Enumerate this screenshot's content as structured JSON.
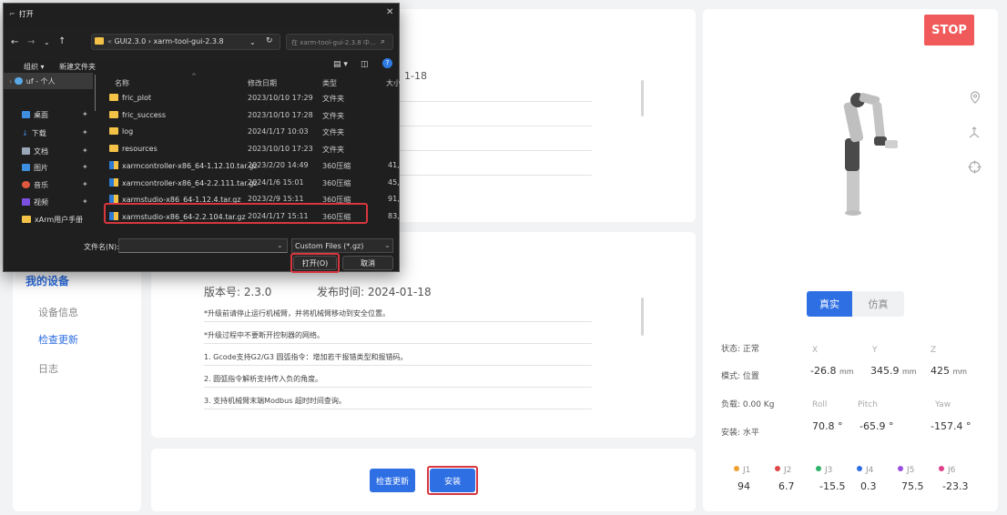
{
  "nav": {
    "group": "我的设备",
    "items": [
      "设备信息",
      "检查更新",
      "日志"
    ],
    "active": "检查更新"
  },
  "top_panel": {
    "date_fragment": "1-18"
  },
  "update": {
    "version": "版本号: 2.3.0",
    "release": "发布时间: 2024-01-18",
    "notes": [
      "*升级前请停止运行机械臂，并将机械臂移动到安全位置。",
      "*升级过程中不要断开控制器的网络。",
      "1. Gcode支持G2/G3 圆弧指令：增加若干报错类型和报错码。",
      "2. 圆弧指令解析支持传入负的角度。",
      "3. 支持机械臂末端Modbus 超时时间查询。"
    ]
  },
  "actions": {
    "check": "检查更新",
    "install": "安装"
  },
  "robot": {
    "stop": "STOP",
    "mode_real": "真实",
    "mode_sim": "仿真",
    "status": "状态: 正常",
    "mode": "模式: 位置",
    "payload": "负载: 0.00 Kg",
    "mount": "安装: 水平",
    "coords": {
      "x_label": "X",
      "y_label": "Y",
      "z_label": "Z",
      "x": "-26.8",
      "y": "345.9",
      "z": "425",
      "unit": "mm",
      "roll_label": "Roll",
      "pitch_label": "Pitch",
      "yaw_label": "Yaw",
      "roll": "70.8 °",
      "pitch": "-65.9 °",
      "yaw": "-157.4 °"
    },
    "joints": [
      {
        "name": "J1",
        "value": "94",
        "color": "#f0a030"
      },
      {
        "name": "J2",
        "value": "6.7",
        "color": "#e04848"
      },
      {
        "name": "J3",
        "value": "-15.5",
        "color": "#2fb36a"
      },
      {
        "name": "J4",
        "value": "0.3",
        "color": "#2f6fe4"
      },
      {
        "name": "J5",
        "value": "75.5",
        "color": "#9b4fe0"
      },
      {
        "name": "J6",
        "value": "-23.3",
        "color": "#e0408a"
      }
    ]
  },
  "dialog": {
    "title": "打开",
    "path_prefix": "«",
    "path1": "GUI2.3.0",
    "path_sep": "›",
    "path2": "xarm-tool-gui-2.3.8",
    "search_placeholder": "在 xarm-tool-gui-2.3.8 中...",
    "organize": "组织 ▾",
    "new_folder": "新建文件夹",
    "col_name": "名称",
    "col_date": "修改日期",
    "col_type": "类型",
    "col_size": "大小",
    "sidebar": [
      "uf - 个人",
      "桌面",
      "下载",
      "文档",
      "图片",
      "音乐",
      "视频",
      "xArm用户手册"
    ],
    "files": [
      {
        "name": "fric_plot",
        "date": "2023/10/10 17:29",
        "type": "文件夹",
        "size": ""
      },
      {
        "name": "fric_success",
        "date": "2023/10/10 17:28",
        "type": "文件夹",
        "size": ""
      },
      {
        "name": "log",
        "date": "2024/1/17 10:03",
        "type": "文件夹",
        "size": ""
      },
      {
        "name": "resources",
        "date": "2023/10/10 17:23",
        "type": "文件夹",
        "size": ""
      },
      {
        "name": "xarmcontroller-x86_64-1.12.10.tar.gz",
        "date": "2023/2/20 14:49",
        "type": "360压缩",
        "size": "41,"
      },
      {
        "name": "xarmcontroller-x86_64-2.2.111.tar.gz",
        "date": "2024/1/6 15:01",
        "type": "360压缩",
        "size": "45,"
      },
      {
        "name": "xarmstudio-x86_64-1.12.4.tar.gz",
        "date": "2023/2/9 15:11",
        "type": "360压缩",
        "size": "91,"
      },
      {
        "name": "xarmstudio-x86_64-2.2.104.tar.gz",
        "date": "2024/1/17 15:11",
        "type": "360压缩",
        "size": "83,"
      }
    ],
    "filename_label": "文件名(N):",
    "filter": "Custom Files (*.gz)",
    "open": "打开(O)",
    "cancel": "取消"
  }
}
